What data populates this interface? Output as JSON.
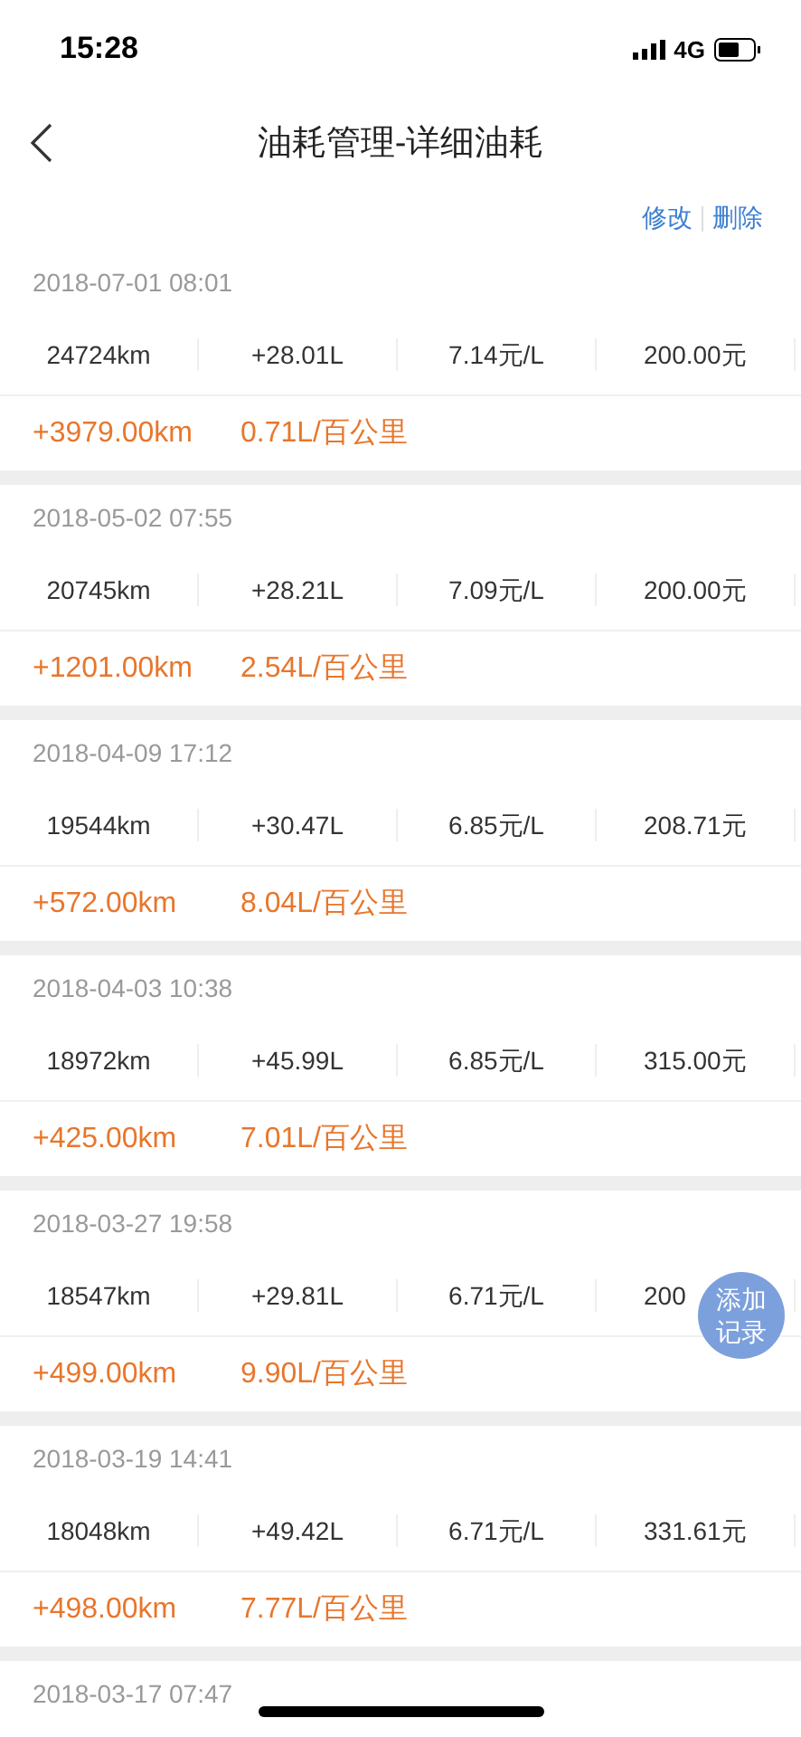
{
  "status_bar": {
    "time": "15:28",
    "network": "4G"
  },
  "nav": {
    "title": "油耗管理-详细油耗"
  },
  "actions": [
    "修改",
    "删除"
  ],
  "records": [
    {
      "date": "2018-07-01 08:01",
      "values": [
        "24724km",
        "+28.01L",
        "7.14元/L",
        "200.00元"
      ],
      "distance": "+3979.00km",
      "consumption": "0.71L/百公里"
    },
    {
      "date": "2018-05-02 07:55",
      "values": [
        "20745km",
        "+28.21L",
        "7.09元/L",
        "200.00元"
      ],
      "distance": "+1201.00km",
      "consumption": "2.54L/百公里"
    },
    {
      "date": "2018-04-09 17:12",
      "values": [
        "19544km",
        "+30.47L",
        "6.85元/L",
        "208.71元"
      ],
      "distance": "+572.00km",
      "consumption": "8.04L/百公里"
    },
    {
      "date": "2018-04-03 10:38",
      "values": [
        "18972km",
        "+45.99L",
        "6.85元/L",
        "315.00元"
      ],
      "distance": "+425.00km",
      "consumption": "7.01L/百公里"
    },
    {
      "date": "2018-03-27 19:58",
      "values": [
        "18547km",
        "+29.81L",
        "6.71元/L",
        "200"
      ],
      "distance": "+499.00km",
      "consumption": "9.90L/百公里"
    },
    {
      "date": "2018-03-19 14:41",
      "values": [
        "18048km",
        "+49.42L",
        "6.71元/L",
        "331.61元"
      ],
      "distance": "+498.00km",
      "consumption": "7.77L/百公里"
    },
    {
      "date": "2018-03-17 07:47"
    }
  ],
  "fab": {
    "label": "添加记录"
  }
}
